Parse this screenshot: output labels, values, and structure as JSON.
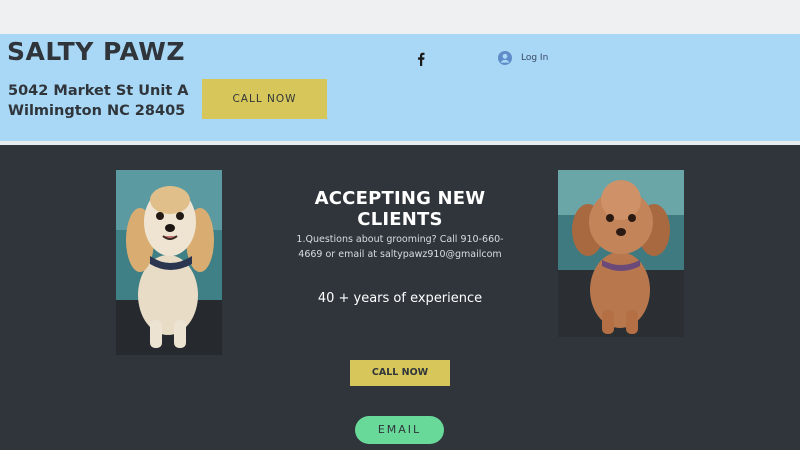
{
  "header": {
    "brand": "SALTY PAWZ",
    "address_line1": "5042 Market St Unit A",
    "address_line2": "Wilmington NC 28405",
    "call_label": "CALL NOW",
    "social_icon": "facebook-icon",
    "login_label": "Log In",
    "login_icon": "user-avatar-icon"
  },
  "main": {
    "title": "ACCEPTING NEW CLIENTS",
    "question_line1": "1.Questions about grooming?  Call 910-660-",
    "question_line2": "4669 or email at saltypawz910@gmailcom",
    "experience": "40 + years of experience",
    "call_label": "CALL NOW",
    "email_label": "EMAIL"
  },
  "colors": {
    "header_bg": "#a8d8f5",
    "body_bg": "#2f353b",
    "call_button": "#d7c75a",
    "email_button": "#69d99a"
  }
}
